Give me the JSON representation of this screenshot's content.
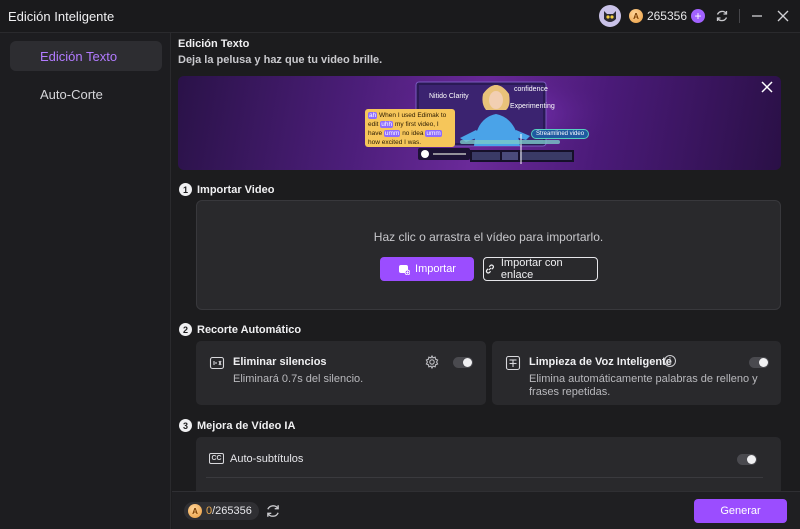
{
  "window": {
    "title": "Edición Inteligente",
    "credits": "265356"
  },
  "sidebar": {
    "items": [
      {
        "label": "Edición Texto",
        "active": true
      },
      {
        "label": "Auto-Corte",
        "active": false
      }
    ]
  },
  "header": {
    "title": "Edición Texto",
    "subtitle": "Deja la pelusa y haz que tu video brille."
  },
  "banner": {
    "labels": {
      "clarity": "Nitido Clarity",
      "confidence": "confidence",
      "experimenting": "Experimenting",
      "streamlined": "Streamlined video"
    },
    "transcript": {
      "ah": "ah",
      "l1": "When I used Edimak",
      "to": "to",
      "edit": "edit",
      "uhh": "uhh",
      "l2": "my  first video,",
      "l3": "I",
      "have": "have",
      "umm": "umm",
      "noidea": "no idea",
      "umm2": "umm",
      "l4": "how excited I was."
    }
  },
  "import_section": {
    "step": "1",
    "title": "Importar Video",
    "prompt": "Haz clic o arrastra el vídeo para importarlo.",
    "import_label": "Importar",
    "link_label": "Importar con enlace"
  },
  "auto_cut": {
    "step": "2",
    "title": "Recorte Automático",
    "cards": [
      {
        "title": "Eliminar silencios",
        "desc": "Eliminará 0.7s del silencio.",
        "enabled": false
      },
      {
        "title": "Limpieza de Voz Inteligente",
        "desc_l1": "Elimina automáticamente palabras de relleno y",
        "desc_l2": "frases repetidas.",
        "enabled": false
      }
    ]
  },
  "ai_enhance": {
    "step": "3",
    "title": "Mejora de Vídeo IA",
    "rows": [
      {
        "label": "Auto-subtítulos",
        "icon_text": "CC",
        "enabled": false
      }
    ]
  },
  "footer": {
    "cost_used": "0",
    "cost_total": "/265356",
    "generate_label": "Generar"
  }
}
